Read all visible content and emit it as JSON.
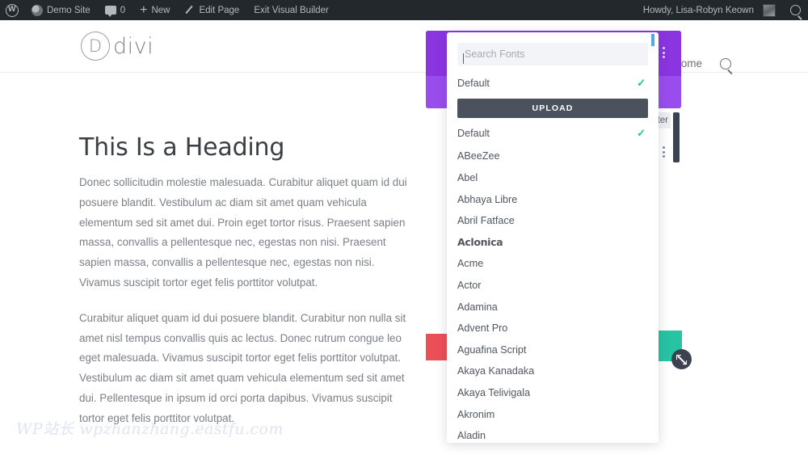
{
  "adminbar": {
    "wp_logo_icon": "wordpress-logo-icon",
    "site_icon": "site-dashboard-icon",
    "site_name": "Demo Site",
    "comments_icon": "comment-bubble-icon",
    "comment_count": "0",
    "new_icon": "plus-icon",
    "new_label": "New",
    "edit_icon": "pencil-icon",
    "edit_label": "Edit Page",
    "exit_label": "Exit Visual Builder",
    "howdy": "Howdy, Lisa-Robyn Keown",
    "avatar_icon": "user-avatar",
    "search_icon": "search-icon"
  },
  "site_header": {
    "logo_letter": "D",
    "logo_text": "divi",
    "nav_item": "Home",
    "nav_search_icon": "search-icon"
  },
  "page": {
    "heading": "This Is a Heading",
    "paragraph_1": "Donec sollicitudin molestie malesuada. Curabitur aliquet quam id dui posuere blandit. Vestibulum ac diam sit amet quam vehicula elementum sed sit amet dui. Proin eget tortor risus. Praesent sapien massa, convallis a pellentesque nec, egestas non nisi. Praesent sapien massa, convallis a pellentesque nec, egestas non nisi. Vivamus suscipit tortor eget felis porttitor volutpat.",
    "paragraph_2": "Curabitur aliquet quam id dui posuere blandit. Curabitur non nulla sit amet nisl tempus convallis quis ac lectus. Donec rutrum congue leo eget malesuada. Vivamus suscipit tortor eget felis porttitor volutpat. Vestibulum ac diam sit amet quam vehicula elementum sed sit amet dui. Pellentesque in ipsum id orci porta dapibus. Vivamus suscipit tortor eget felis porttitor volutpat."
  },
  "watermark": {
    "text": "WP站长  wpzhanzhang.eastfu.com"
  },
  "builder": {
    "partial_chip_label": "ter",
    "resize_handle_icon": "resize-diagonal-icon",
    "module_menu_icon": "vertical-dots-icon",
    "colors": {
      "purple": "#8a35e0",
      "purple_light": "#9a4ded",
      "red": "#ec4f57",
      "teal": "#26c4a3",
      "dark": "#3c4250",
      "blue_tab": "#4fa8e0"
    }
  },
  "font_panel": {
    "search_placeholder": "Search Fonts",
    "search_value": "",
    "selected_default_label": "Default",
    "upload_label": "UPLOAD",
    "check_icon": "checkmark-icon",
    "list_default_label": "Default",
    "fonts": [
      "ABeeZee",
      "Abel",
      "Abhaya Libre",
      "Abril Fatface",
      "Aclonica",
      "Acme",
      "Actor",
      "Adamina",
      "Advent Pro",
      "Aguafina Script",
      "Akaya Kanadaka",
      "Akaya Telivigala",
      "Akronim",
      "Aladin"
    ]
  }
}
